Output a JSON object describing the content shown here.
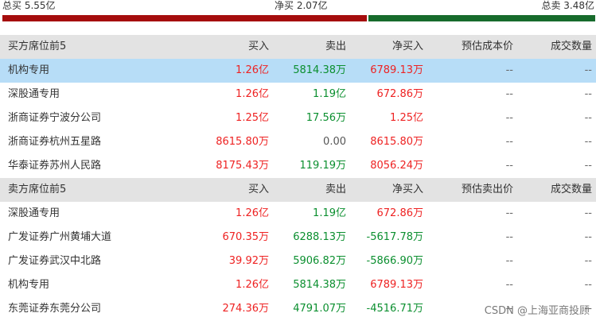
{
  "summary": {
    "total_buy": "总买 5.55亿",
    "net_buy": "净买 2.07亿",
    "total_sell": "总卖 3.48亿",
    "buy_fraction": 0.615,
    "colors": {
      "buy_bar": "#a50d0d",
      "sell_bar": "#176b2c"
    }
  },
  "buy_section": {
    "headers": [
      "买方席位前5",
      "买入",
      "卖出",
      "净买入",
      "预估成本价",
      "成交数量"
    ],
    "rows": [
      {
        "name": "机构专用",
        "buy": "1.26亿",
        "sell": "5814.38万",
        "net": "6789.13万",
        "cost": "--",
        "qty": "--",
        "sell_color": "green",
        "net_color": "red"
      },
      {
        "name": "深股通专用",
        "buy": "1.26亿",
        "sell": "1.19亿",
        "net": "672.86万",
        "cost": "--",
        "qty": "--",
        "sell_color": "green",
        "net_color": "red"
      },
      {
        "name": "浙商证券宁波分公司",
        "buy": "1.25亿",
        "sell": "17.56万",
        "net": "1.25亿",
        "cost": "--",
        "qty": "--",
        "sell_color": "green",
        "net_color": "red"
      },
      {
        "name": "浙商证券杭州五星路",
        "buy": "8615.80万",
        "sell": "0.00",
        "net": "8615.80万",
        "cost": "--",
        "qty": "--",
        "sell_color": "gray",
        "net_color": "red"
      },
      {
        "name": "华泰证券苏州人民路",
        "buy": "8175.43万",
        "sell": "119.19万",
        "net": "8056.24万",
        "cost": "--",
        "qty": "--",
        "sell_color": "green",
        "net_color": "red"
      }
    ]
  },
  "sell_section": {
    "headers": [
      "卖方席位前5",
      "买入",
      "卖出",
      "净买入",
      "预估卖出价",
      "成交数量"
    ],
    "rows": [
      {
        "name": "深股通专用",
        "buy": "1.26亿",
        "sell": "1.19亿",
        "net": "672.86万",
        "cost": "--",
        "qty": "--",
        "sell_color": "green",
        "net_color": "red"
      },
      {
        "name": "广发证券广州黄埔大道",
        "buy": "670.35万",
        "sell": "6288.13万",
        "net": "-5617.78万",
        "cost": "--",
        "qty": "--",
        "sell_color": "green",
        "net_color": "green"
      },
      {
        "name": "广发证券武汉中北路",
        "buy": "39.92万",
        "sell": "5906.82万",
        "net": "-5866.90万",
        "cost": "--",
        "qty": "--",
        "sell_color": "green",
        "net_color": "green"
      },
      {
        "name": "机构专用",
        "buy": "1.26亿",
        "sell": "5814.38万",
        "net": "6789.13万",
        "cost": "--",
        "qty": "--",
        "sell_color": "green",
        "net_color": "red"
      },
      {
        "name": "东莞证券东莞分公司",
        "buy": "274.36万",
        "sell": "4791.07万",
        "net": "-4516.71万",
        "cost": "--",
        "qty": "--",
        "sell_color": "green",
        "net_color": "green"
      }
    ]
  },
  "watermark": "CSDN @上海亚商投顾"
}
